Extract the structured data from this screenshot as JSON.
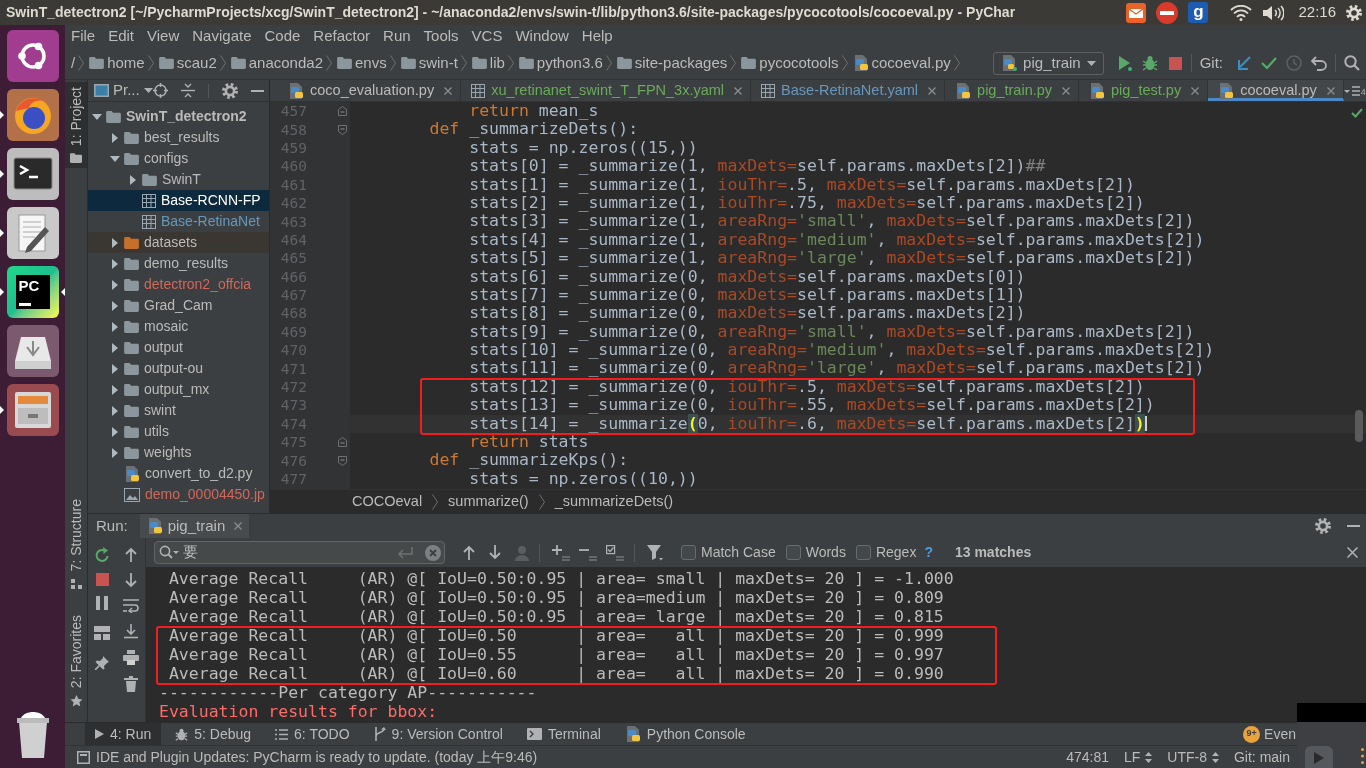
{
  "title_bar": {
    "title": "SwinT_detectron2 [~/PycharmProjects/xcg/SwinT_detectron2] - ~/anaconda2/envs/swin-t/lib/python3.6/site-packages/pycocotools/cocoeval.py - PyChar",
    "tray_logo": "g",
    "clock": "22:16"
  },
  "launcher": [
    {
      "kind": "dash",
      "running": false,
      "focused": false
    },
    {
      "kind": "browser",
      "running": true,
      "focused": false
    },
    {
      "kind": "terminal",
      "running": true,
      "focused": false
    },
    {
      "kind": "editor",
      "running": true,
      "focused": false
    },
    {
      "kind": "ide",
      "logo": "PC",
      "running": true,
      "focused": true
    },
    {
      "kind": "drive",
      "running": false,
      "focused": false
    },
    {
      "kind": "files",
      "running": true,
      "focused": false
    },
    {
      "kind": "trash",
      "running": false,
      "focused": false
    }
  ],
  "menu": [
    "File",
    "Edit",
    "View",
    "Navigate",
    "Code",
    "Refactor",
    "Run",
    "Tools",
    "VCS",
    "Window",
    "Help"
  ],
  "nav_bar": {
    "path": [
      {
        "label": "/",
        "kind": "root"
      },
      {
        "label": "home",
        "kind": "folder"
      },
      {
        "label": "scau2",
        "kind": "folder"
      },
      {
        "label": "anaconda2",
        "kind": "folder"
      },
      {
        "label": "envs",
        "kind": "folder"
      },
      {
        "label": "swin-t",
        "kind": "folder"
      },
      {
        "label": "lib",
        "kind": "folder"
      },
      {
        "label": "python3.6",
        "kind": "folder"
      },
      {
        "label": "site-packages",
        "kind": "folder"
      },
      {
        "label": "pycocotools",
        "kind": "folder"
      },
      {
        "label": "cocoeval.py",
        "kind": "python"
      }
    ],
    "run_config": "pig_train",
    "vcs_label": "Git:"
  },
  "tool_strip": {
    "top": [
      {
        "label": "1: Project",
        "kind": "project",
        "selected": true
      }
    ],
    "bottom": [
      {
        "label": "7: Structure",
        "kind": "structure",
        "selected": false
      },
      {
        "label": "2: Favorites",
        "kind": "favorites",
        "selected": false
      }
    ]
  },
  "project": {
    "view": "Pr...",
    "tree": [
      {
        "label": "SwinT_detectron2",
        "kind": "folder",
        "expanded": true,
        "selected": false,
        "children": [
          {
            "label": "best_results",
            "kind": "folder",
            "expanded": false,
            "selected": false
          },
          {
            "label": "configs",
            "kind": "folder",
            "expanded": true,
            "selected": false,
            "children": [
              {
                "label": "SwinT",
                "kind": "folder",
                "expanded": false,
                "selected": false
              },
              {
                "label": "Base-RCNN-FP",
                "kind": "config",
                "selected": true
              },
              {
                "label": "Base-RetinaNet",
                "kind": "config",
                "color": "#6897bb",
                "selected": false
              }
            ]
          },
          {
            "label": "datasets",
            "kind": "excluded",
            "expanded": false,
            "selected": false
          },
          {
            "label": "demo_results",
            "kind": "folder",
            "expanded": false,
            "selected": false
          },
          {
            "label": "detectron2_offcia",
            "kind": "folder",
            "color": "#d1675a",
            "expanded": false,
            "selected": false
          },
          {
            "label": "Grad_Cam",
            "kind": "folder",
            "expanded": false,
            "selected": false
          },
          {
            "label": "mosaic",
            "kind": "folder",
            "expanded": false,
            "selected": false
          },
          {
            "label": "output",
            "kind": "folder",
            "expanded": false,
            "selected": false
          },
          {
            "label": "output-ou",
            "kind": "folder",
            "expanded": false,
            "selected": false
          },
          {
            "label": "output_mx",
            "kind": "folder",
            "expanded": false,
            "selected": false
          },
          {
            "label": "swint",
            "kind": "folder",
            "expanded": false,
            "selected": false
          },
          {
            "label": "utils",
            "kind": "folder",
            "expanded": false,
            "selected": false
          },
          {
            "label": "weights",
            "kind": "folder",
            "expanded": false,
            "selected": false
          },
          {
            "label": "convert_to_d2.py",
            "kind": "python",
            "selected": false
          },
          {
            "label": "demo_00004450.jp",
            "kind": "image",
            "color": "#d1675a",
            "selected": false
          }
        ]
      }
    ]
  },
  "editor": {
    "tabs": [
      {
        "label": "coco_evaluation.py",
        "kind": "python",
        "color": "#bbbbbb",
        "selected": false
      },
      {
        "label": "xu_retinanet_swint_T_FPN_3x.yaml",
        "kind": "config",
        "color": "#6aab5b",
        "selected": false
      },
      {
        "label": "Base-RetinaNet.yaml",
        "kind": "config",
        "color": "#6897bb",
        "selected": false
      },
      {
        "label": "pig_train.py",
        "kind": "python",
        "color": "#6aab5b",
        "selected": false
      },
      {
        "label": "pig_test.py",
        "kind": "python",
        "color": "#6aab5b",
        "selected": false
      },
      {
        "label": "cocoeval.py",
        "kind": "python",
        "color": "#bbbbbb",
        "selected": true
      }
    ],
    "tab_overflow": "4",
    "lines": [
      {
        "number": "457",
        "kind": "closer",
        "current": false,
        "boxed": false,
        "tokens": [
          {
            "text": "            return",
            "kind": "keyword"
          },
          " mean_s"
        ]
      },
      {
        "number": "458",
        "kind": "opener",
        "current": false,
        "boxed": false,
        "tokens": [
          {
            "text": "        def",
            "kind": "keyword"
          },
          " _summarizeDets():"
        ]
      },
      {
        "number": "459",
        "kind": "plain",
        "current": false,
        "boxed": false,
        "tokens": [
          "            stats = np.zeros((15,))"
        ]
      },
      {
        "number": "460",
        "kind": "plain",
        "current": false,
        "boxed": false,
        "tokens": [
          "            stats[0] = _summarize(1, ",
          {
            "text": "maxDets=",
            "kind": "param"
          },
          "self.params.maxDets[2])",
          {
            "text": "##",
            "kind": "comment"
          }
        ]
      },
      {
        "number": "461",
        "kind": "plain",
        "current": false,
        "boxed": false,
        "tokens": [
          "            stats[1] = _summarize(1, ",
          {
            "text": "iouThr=",
            "kind": "param"
          },
          ".5, ",
          {
            "text": "maxDets=",
            "kind": "param"
          },
          "self.params.maxDets[2])"
        ]
      },
      {
        "number": "462",
        "kind": "plain",
        "current": false,
        "boxed": false,
        "tokens": [
          "            stats[2] = _summarize(1, ",
          {
            "text": "iouThr=",
            "kind": "param"
          },
          ".75, ",
          {
            "text": "maxDets=",
            "kind": "param"
          },
          "self.params.maxDets[2])"
        ]
      },
      {
        "number": "463",
        "kind": "plain",
        "current": false,
        "boxed": false,
        "tokens": [
          "            stats[3] = _summarize(1, ",
          {
            "text": "areaRng=",
            "kind": "param"
          },
          {
            "text": "'small'",
            "kind": "string"
          },
          ", ",
          {
            "text": "maxDets=",
            "kind": "param"
          },
          "self.params.maxDets[2])"
        ]
      },
      {
        "number": "464",
        "kind": "plain",
        "current": false,
        "boxed": false,
        "tokens": [
          "            stats[4] = _summarize(1, ",
          {
            "text": "areaRng=",
            "kind": "param"
          },
          {
            "text": "'medium'",
            "kind": "string"
          },
          ", ",
          {
            "text": "maxDets=",
            "kind": "param"
          },
          "self.params.maxDets[2])"
        ]
      },
      {
        "number": "465",
        "kind": "plain",
        "current": false,
        "boxed": false,
        "tokens": [
          "            stats[5] = _summarize(1, ",
          {
            "text": "areaRng=",
            "kind": "param"
          },
          {
            "text": "'large'",
            "kind": "string"
          },
          ", ",
          {
            "text": "maxDets=",
            "kind": "param"
          },
          "self.params.maxDets[2])"
        ]
      },
      {
        "number": "466",
        "kind": "plain",
        "current": false,
        "boxed": false,
        "tokens": [
          "            stats[6] = _summarize(0, ",
          {
            "text": "maxDets=",
            "kind": "param"
          },
          "self.params.maxDets[0])"
        ]
      },
      {
        "number": "467",
        "kind": "plain",
        "current": false,
        "boxed": false,
        "tokens": [
          "            stats[7] = _summarize(0, ",
          {
            "text": "maxDets=",
            "kind": "param"
          },
          "self.params.maxDets[1])"
        ]
      },
      {
        "number": "468",
        "kind": "plain",
        "current": false,
        "boxed": false,
        "tokens": [
          "            stats[8] = _summarize(0, ",
          {
            "text": "maxDets=",
            "kind": "param"
          },
          "self.params.maxDets[2])"
        ]
      },
      {
        "number": "469",
        "kind": "plain",
        "current": false,
        "boxed": false,
        "tokens": [
          "            stats[9] = _summarize(0, ",
          {
            "text": "areaRng=",
            "kind": "param"
          },
          {
            "text": "'small'",
            "kind": "string"
          },
          ", ",
          {
            "text": "maxDets=",
            "kind": "param"
          },
          "self.params.maxDets[2])"
        ]
      },
      {
        "number": "470",
        "kind": "plain",
        "current": false,
        "boxed": false,
        "tokens": [
          "            stats[10] = _summarize(0, ",
          {
            "text": "areaRng=",
            "kind": "param"
          },
          {
            "text": "'medium'",
            "kind": "string"
          },
          ", ",
          {
            "text": "maxDets=",
            "kind": "param"
          },
          "self.params.maxDets[2])"
        ]
      },
      {
        "number": "471",
        "kind": "plain",
        "current": false,
        "boxed": false,
        "tokens": [
          "            stats[11] = _summarize(0, ",
          {
            "text": "areaRng=",
            "kind": "param"
          },
          {
            "text": "'large'",
            "kind": "string"
          },
          ", ",
          {
            "text": "maxDets=",
            "kind": "param"
          },
          "self.params.maxDets[2])"
        ]
      },
      {
        "number": "472",
        "kind": "plain",
        "current": false,
        "boxed": true,
        "tokens": [
          "            stats[12] = _summarize(0, ",
          {
            "text": "iouThr=",
            "kind": "param"
          },
          ".5, ",
          {
            "text": "maxDets=",
            "kind": "param"
          },
          "self.params.maxDets[2])"
        ]
      },
      {
        "number": "473",
        "kind": "plain",
        "current": false,
        "boxed": true,
        "tokens": [
          "            stats[13] = _summarize(0, ",
          {
            "text": "iouThr=",
            "kind": "param"
          },
          ".55, ",
          {
            "text": "maxDets=",
            "kind": "param"
          },
          "self.params.maxDets[2])"
        ]
      },
      {
        "number": "474",
        "kind": "plain",
        "current": true,
        "boxed": true,
        "tokens": [
          "            stats[14] = _summarize",
          {
            "text": "(",
            "kind": "brace"
          },
          "0, ",
          {
            "text": "iouThr=",
            "kind": "param"
          },
          ".6, ",
          {
            "text": "maxDets=",
            "kind": "param"
          },
          "self.params.maxDets[2]",
          {
            "text": ")",
            "kind": "brace"
          }
        ]
      },
      {
        "number": "475",
        "kind": "closer",
        "current": false,
        "boxed": false,
        "tokens": [
          {
            "text": "            return",
            "kind": "keyword"
          },
          " stats"
        ]
      },
      {
        "number": "476",
        "kind": "opener",
        "current": false,
        "boxed": false,
        "tokens": [
          {
            "text": "        def",
            "kind": "keyword"
          },
          " _summarizeKps():"
        ]
      },
      {
        "number": "477",
        "kind": "plain",
        "current": false,
        "boxed": false,
        "tokens": [
          "            stats = np.zeros((10,))"
        ]
      }
    ],
    "breadcrumbs": [
      "COCOeval",
      "summarize()",
      "_summarizeDets()"
    ]
  },
  "run": {
    "label": "Run:",
    "tabs": [
      {
        "label": "pig_train",
        "selected": true
      }
    ],
    "search": {
      "value": "要",
      "options": [
        {
          "label": "Match Case",
          "checked": false
        },
        {
          "label": "Words",
          "checked": false
        },
        {
          "label": "Regex",
          "checked": false
        }
      ],
      "help": "?",
      "matches": "13 matches"
    },
    "output": [
      {
        "text": " Average Recall     (AR) @[ IoU=0.50:0.95 | area= small | maxDets= 20 ] = -1.000",
        "error": false,
        "boxed": false
      },
      {
        "text": " Average Recall     (AR) @[ IoU=0.50:0.95 | area=medium | maxDets= 20 ] = 0.809",
        "error": false,
        "boxed": false
      },
      {
        "text": " Average Recall     (AR) @[ IoU=0.50:0.95 | area= large | maxDets= 20 ] = 0.815",
        "error": false,
        "boxed": false
      },
      {
        "text": " Average Recall     (AR) @[ IoU=0.50      | area=   all | maxDets= 20 ] = 0.999",
        "error": false,
        "boxed": true
      },
      {
        "text": " Average Recall     (AR) @[ IoU=0.55      | area=   all | maxDets= 20 ] = 0.997",
        "error": false,
        "boxed": true
      },
      {
        "text": " Average Recall     (AR) @[ IoU=0.60      | area=   all | maxDets= 20 ] = 0.990",
        "error": false,
        "boxed": true
      },
      {
        "text": "------------Per category AP-----------",
        "error": false,
        "boxed": false
      },
      {
        "text": "Evaluation results for bbox:",
        "error": true,
        "boxed": false
      }
    ]
  },
  "bottom_bar": {
    "tabs": [
      {
        "label": "4: Run",
        "kind": "run",
        "selected": true
      },
      {
        "label": "5: Debug",
        "kind": "debug",
        "selected": false
      },
      {
        "label": "6: TODO",
        "kind": "todo",
        "selected": false
      },
      {
        "label": "9: Version Control",
        "kind": "vcs",
        "selected": false
      },
      {
        "label": "Terminal",
        "kind": "terminal",
        "selected": false
      },
      {
        "label": "Python Console",
        "kind": "console",
        "selected": false
      }
    ],
    "event_log": {
      "label": "Even",
      "badge": "9+"
    }
  },
  "status_bar": {
    "message": "IDE and Plugin Updates: PyCharm is ready to update. (today 上午9:46)",
    "position": "474:81",
    "line_separator": "LF",
    "encoding": "UTF-8",
    "branch": "Git: main"
  }
}
